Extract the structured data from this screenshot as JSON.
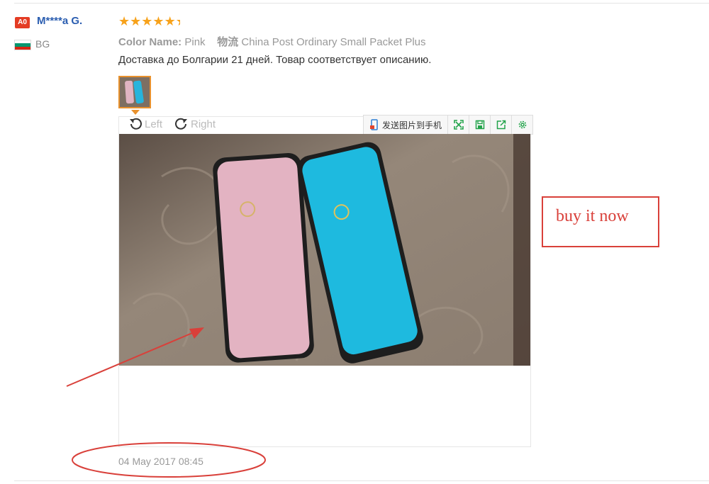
{
  "reviewer": {
    "badge": "A0",
    "name": "M****a G.",
    "country_code": "BG",
    "flag_colors": [
      "#ffffff",
      "#00966e",
      "#d62612"
    ]
  },
  "rating": {
    "stars": 5
  },
  "attributes": {
    "color_label": "Color Name:",
    "color_value": "Pink",
    "shipping_label": "物流",
    "shipping_value": "China Post Ordinary Small Packet Plus"
  },
  "review_text": "Доставка до Болгарии 21 дней. Товар соответствует описанию.",
  "viewer": {
    "rotate_left": "Left",
    "rotate_right": "Right",
    "send_to_phone": "发送图片到手机",
    "icons": [
      "phone-icon",
      "fullscreen-icon",
      "save-icon",
      "share-icon",
      "settings-icon"
    ]
  },
  "date": "04 May 2017 08:45",
  "annotation": {
    "label": "buy it now",
    "color": "#d9403a"
  },
  "colors": {
    "accent_orange": "#e8912d",
    "star": "#f7a21b",
    "link_blue": "#2a5db0",
    "badge_red": "#e43c24"
  }
}
